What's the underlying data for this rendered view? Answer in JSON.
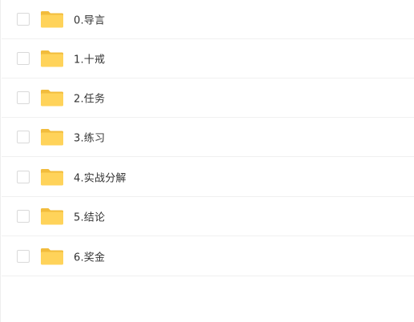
{
  "colors": {
    "folder_body": "#FFD35A",
    "folder_tab": "#F2BC3C",
    "text": "#333333",
    "divider": "#f0f0f0",
    "checkbox_border": "#d9d9d9"
  },
  "files": [
    {
      "name": "0.导言",
      "icon": "folder-icon",
      "checked": false
    },
    {
      "name": "1.十戒",
      "icon": "folder-icon",
      "checked": false
    },
    {
      "name": "2.任务",
      "icon": "folder-icon",
      "checked": false
    },
    {
      "name": "3.练习",
      "icon": "folder-icon",
      "checked": false
    },
    {
      "name": "4.实战分解",
      "icon": "folder-icon",
      "checked": false
    },
    {
      "name": "5.结论",
      "icon": "folder-icon",
      "checked": false
    },
    {
      "name": "6.奖金",
      "icon": "folder-icon",
      "checked": false
    }
  ]
}
